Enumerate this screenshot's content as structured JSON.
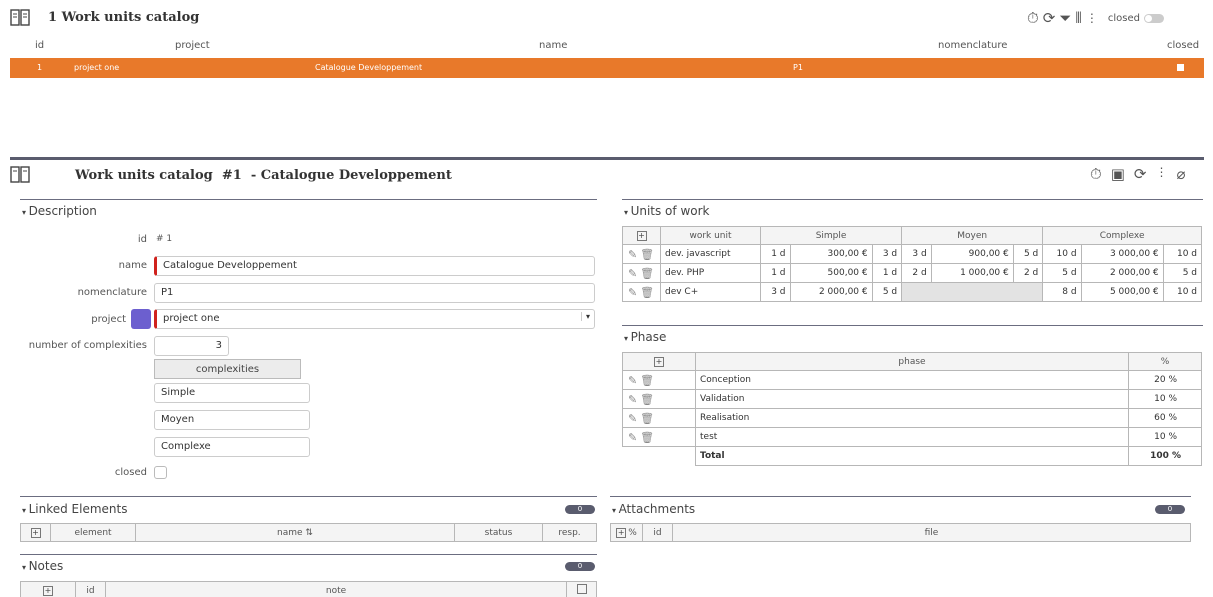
{
  "header": {
    "count": "1",
    "title": "Work units catalog",
    "closed_label": "closed"
  },
  "list": {
    "columns": [
      "id",
      "project",
      "name",
      "nomenclature",
      "closed"
    ],
    "row": {
      "id": "1",
      "project": "project one",
      "name": "Catalogue Developpement",
      "nomenclature": "P1"
    }
  },
  "detail": {
    "title": "Work units catalog",
    "id_ref": "#1",
    "subtitle": "- Catalogue Developpement"
  },
  "description": {
    "section": "Description",
    "id_label": "id",
    "id_value": "# 1",
    "name_label": "name",
    "name_value": "Catalogue Developpement",
    "nomenclature_label": "nomenclature",
    "nomenclature_value": "P1",
    "project_label": "project",
    "project_value": "project one",
    "complexities_label": "number of complexities",
    "complexities_value": "3",
    "complexities_button": "complexities",
    "complexity_names": [
      "Simple",
      "Moyen",
      "Complexe"
    ],
    "closed_label": "closed"
  },
  "units": {
    "section": "Units of work",
    "col_work_unit": "work unit",
    "col_simple": "Simple",
    "col_moyen": "Moyen",
    "col_complexe": "Complexe",
    "rows": [
      {
        "name": "dev. javascript",
        "s": [
          "1 d",
          "300,00 €",
          "3 d"
        ],
        "m": [
          "3 d",
          "900,00 €",
          "5 d"
        ],
        "c": [
          "10 d",
          "3 000,00 €",
          "10 d"
        ]
      },
      {
        "name": "dev. PHP",
        "s": [
          "1 d",
          "500,00 €",
          "1 d"
        ],
        "m": [
          "2 d",
          "1 000,00 €",
          "2 d"
        ],
        "c": [
          "5 d",
          "2 000,00 €",
          "5 d"
        ]
      },
      {
        "name": "dev C+",
        "s": [
          "3 d",
          "2 000,00 €",
          "5 d"
        ],
        "m": [
          "",
          "",
          ""
        ],
        "c": [
          "8 d",
          "5 000,00 €",
          "10 d"
        ]
      }
    ]
  },
  "phase": {
    "section": "Phase",
    "col_phase": "phase",
    "col_pct": "%",
    "rows": [
      {
        "name": "Conception",
        "pct": "20 %"
      },
      {
        "name": "Validation",
        "pct": "10 %"
      },
      {
        "name": "Realisation",
        "pct": "60 %"
      },
      {
        "name": "test",
        "pct": "10 %"
      }
    ],
    "total_label": "Total",
    "total_value": "100 %"
  },
  "linked": {
    "section": "Linked Elements",
    "count": "0",
    "col_element": "element",
    "col_name": "name ⇅",
    "col_status": "status",
    "col_resp": "resp."
  },
  "attachments": {
    "section": "Attachments",
    "count": "0",
    "col_id": "id",
    "col_file": "file"
  },
  "notes": {
    "section": "Notes",
    "count": "0",
    "col_id": "id",
    "col_note": "note"
  },
  "colors": {
    "accent": "#e8792a",
    "project": "#6c5fcf",
    "required": "#d0221d",
    "header_bar": "#5a5c6e"
  }
}
